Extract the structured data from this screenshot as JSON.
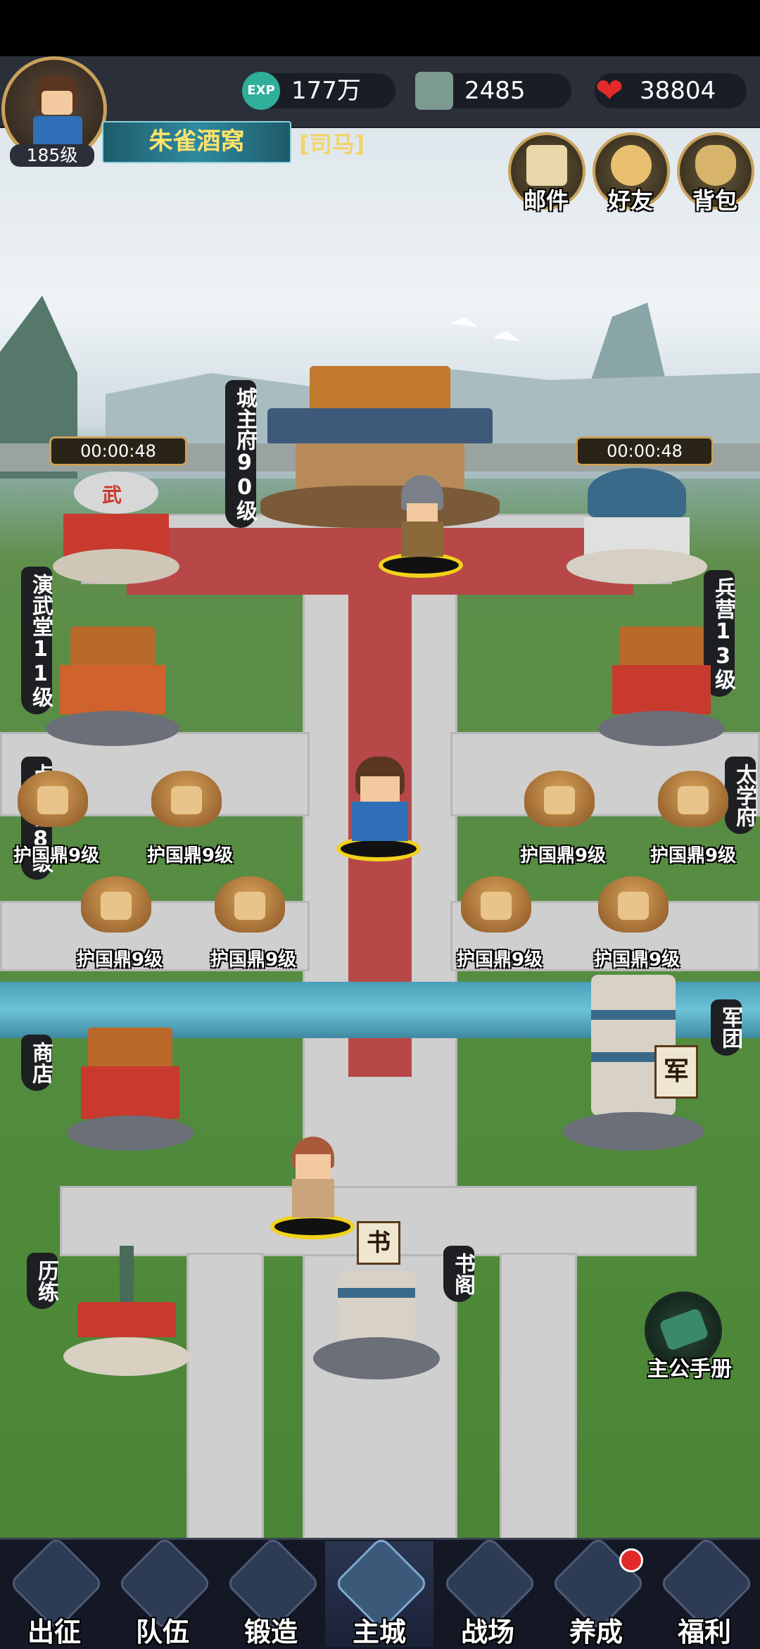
{
  "header": {
    "player_level": "185级",
    "player_name": "朱雀酒窝",
    "rank": "[司马]",
    "resources": {
      "exp_icon": "EXP",
      "exp": "177万",
      "jade": "2485",
      "stamina": "38804"
    },
    "buttons": {
      "mail": "邮件",
      "friends": "好友",
      "bag": "背包"
    }
  },
  "city": {
    "buildings": {
      "training_hall": "演武堂11级",
      "training_hall_timer": "00:00:48",
      "city_lord": "城主府90级",
      "barracks": "兵营13级",
      "barracks_timer": "00:00:48",
      "general_platform": "点将台8级",
      "academy": "太学府",
      "shop": "商店",
      "legion": "军团",
      "trials": "历练",
      "library": "书阁"
    },
    "signs": {
      "martial": "武",
      "library_sign": "书",
      "legion_flag": "军"
    },
    "tripods": [
      "护国鼎9级",
      "护国鼎9级",
      "护国鼎9级",
      "护国鼎9级",
      "护国鼎9级",
      "护国鼎9级",
      "护国鼎9级",
      "护国鼎9级"
    ],
    "handbook": "主公手册"
  },
  "nav": {
    "tabs": [
      "出征",
      "队伍",
      "锻造",
      "主城",
      "战场",
      "养成",
      "福利"
    ],
    "active": "主城"
  },
  "colors": {
    "accent_gold": "#c9a15a",
    "name_text": "#ffe36a",
    "carpet": "#b84848",
    "notification": "#e22a2a"
  }
}
